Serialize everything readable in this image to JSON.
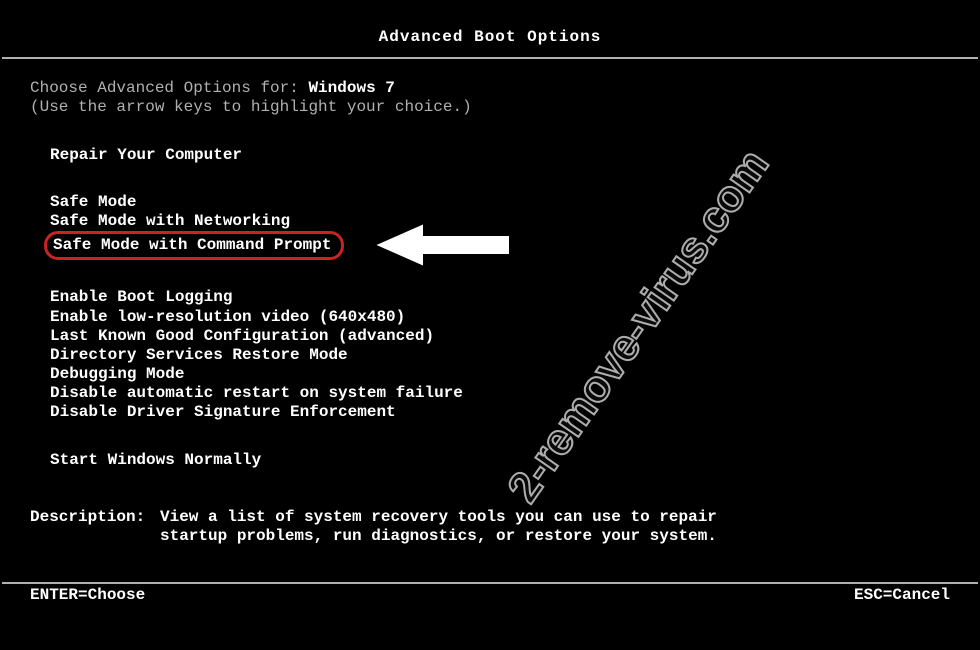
{
  "title": "Advanced Boot Options",
  "intro": {
    "prefix": "Choose Advanced Options for: ",
    "os": "Windows 7",
    "hint": "(Use the arrow keys to highlight your choice.)"
  },
  "groups": {
    "repair": "Repair Your Computer",
    "safe": [
      "Safe Mode",
      "Safe Mode with Networking",
      "Safe Mode with Command Prompt"
    ],
    "advanced": [
      "Enable Boot Logging",
      "Enable low-resolution video (640x480)",
      "Last Known Good Configuration (advanced)",
      "Directory Services Restore Mode",
      "Debugging Mode",
      "Disable automatic restart on system failure",
      "Disable Driver Signature Enforcement"
    ],
    "normal": "Start Windows Normally"
  },
  "description": {
    "label": "Description:",
    "text": "View a list of system recovery tools you can use to repair startup problems, run diagnostics, or restore your system."
  },
  "footer": {
    "enter": "ENTER=Choose",
    "esc": "ESC=Cancel"
  },
  "watermark": "2-remove-virus.com",
  "colors": {
    "highlight_border": "#cc2222",
    "text_bright": "#ffffff",
    "text_dim": "#b0b0b0",
    "bg": "#000000"
  }
}
